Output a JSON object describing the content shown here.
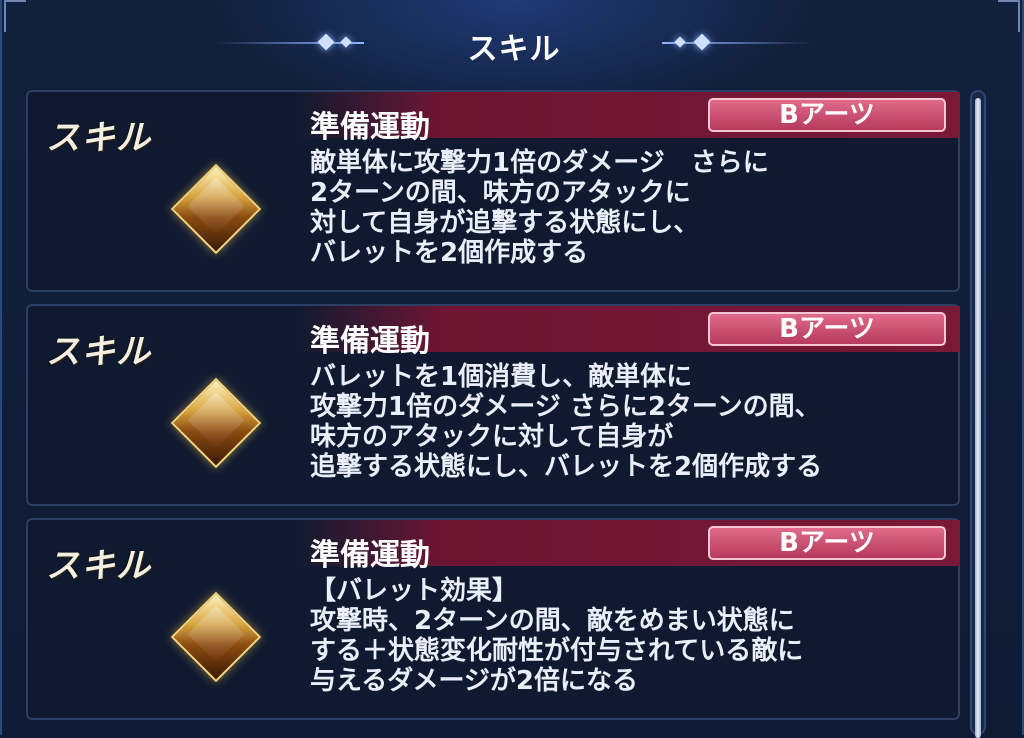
{
  "header": {
    "title": "スキル"
  },
  "skills": [
    {
      "label": "スキル",
      "name": "準備運動",
      "card_type": "Bアーツ",
      "icon": "gem-icon",
      "description": "敵単体に攻撃力1倍のダメージ　さらに\n2ターンの間、味方のアタックに\n対して自身が追撃する状態にし、\nバレットを2個作成する"
    },
    {
      "label": "スキル",
      "name": "準備運動",
      "card_type": "Bアーツ",
      "icon": "gem-icon",
      "description": "バレットを1個消費し、敵単体に\n攻撃力1倍のダメージ さらに2ターンの間、\n味方のアタックに対して自身が\n追撃する状態にし、バレットを2個作成する"
    },
    {
      "label": "スキル",
      "name": "準備運動",
      "card_type": "Bアーツ",
      "icon": "gem-icon",
      "description": "【バレット効果】\n攻撃時、2ターンの間、敵をめまい状態に\nする＋状態変化耐性が付与されている敵に\n与えるダメージが2倍になる"
    }
  ]
}
